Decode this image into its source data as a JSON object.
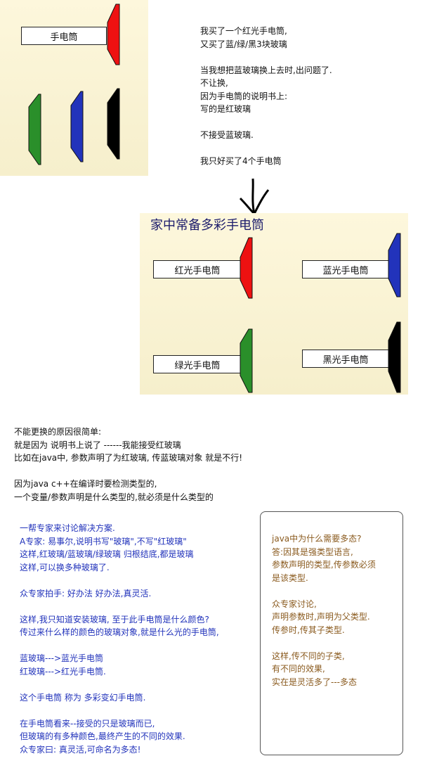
{
  "panel1": {
    "label": "手电筒",
    "colors": {
      "red": "#ee1111",
      "green": "#2a8f2a",
      "blue": "#2233bb",
      "black": "#000000"
    }
  },
  "story_lines": [
    "我买了一个红光手电筒,",
    "又买了蓝/绿/黑3块玻璃",
    "",
    "当我想把蓝玻璃换上去时,出问题了.",
    "不让换,",
    "因为手电筒的说明书上:",
    "写的是红玻璃",
    "",
    "不接受蓝玻璃.",
    "",
    "我只好买了4个手电筒"
  ],
  "panel2": {
    "title": "家中常备多彩手电筒",
    "flashlights": [
      {
        "label": "红光手电筒",
        "color": "#ee1111"
      },
      {
        "label": "蓝光手电筒",
        "color": "#2233bb"
      },
      {
        "label": "绿光手电筒",
        "color": "#2a8f2a"
      },
      {
        "label": "黑光手电筒",
        "color": "#000000"
      }
    ]
  },
  "reason_lines": [
    "不能更换的原因很简单:",
    "就是因为 说明书上说了 ------我能接受红玻璃",
    "比如在java中, 参数声明了为红玻璃, 传蓝玻璃对象 就是不行!",
    "",
    "因为java c++在编译时要检测类型的,",
    "一个变量/参数声明是什么类型的,就必须是什么类型的"
  ],
  "expert_lines": [
    "一帮专家来讨论解决方案.",
    "A专家: 易事尔,说明书写\"玻璃\",不写\"红玻璃\"",
    "这样,红玻璃/蓝玻璃/绿玻璃 归根结底,都是玻璃",
    "这样,可以换多种玻璃了.",
    "",
    "众专家拍手: 好办法 好办法,真灵活.",
    "",
    "这样,我只知道安装玻璃, 至于此手电筒是什么颜色?",
    "传过来什么样的颜色的玻璃对象,就是什么光的手电筒,",
    "",
    "蓝玻璃--->蓝光手电筒",
    "红玻璃--->红光手电筒.",
    "",
    "这个手电筒 称为 多彩变幻手电筒.",
    "",
    "在手电筒看来--接受的只是玻璃而已,",
    "但玻璃的有多种颜色,最终产生的不同的效果.",
    "众专家曰: 真灵活,可命名为多态!"
  ],
  "note_lines": [
    "java中为什么需要多态?",
    "答:因其是强类型语言,",
    "参数声明的类型,传参数必须",
    "是该类型.",
    "",
    "众专家讨论,",
    "声明参数时,声明为父类型.",
    "传参时,传其子类型.",
    "",
    "这样,传不同的子类,",
    "有不同的效果,",
    "实在是灵活多了---多态"
  ]
}
